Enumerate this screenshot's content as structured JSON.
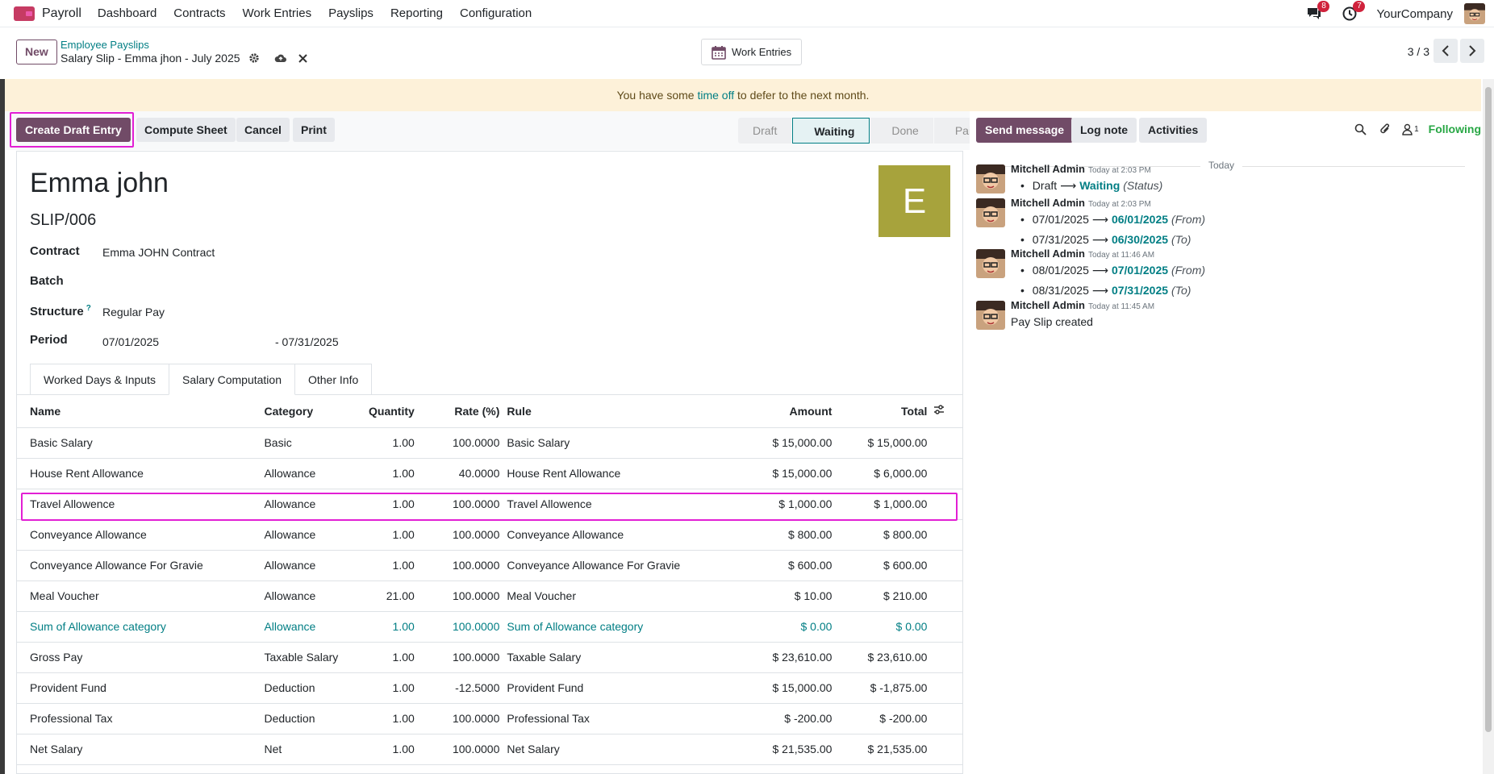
{
  "topbar": {
    "app_name": "Payroll",
    "menu": [
      "Dashboard",
      "Contracts",
      "Work Entries",
      "Payslips",
      "Reporting",
      "Configuration"
    ],
    "messages_badge": "8",
    "activities_badge": "7",
    "company": "YourCompany"
  },
  "control_panel": {
    "new_label": "New",
    "breadcrumb_parent": "Employee Payslips",
    "breadcrumb_current": "Salary Slip - Emma jhon - July 2025",
    "work_entries_label": "Work Entries",
    "pager": "3 / 3"
  },
  "banner": {
    "prefix": "You have some ",
    "link": "time off",
    "suffix": " to defer to the next month."
  },
  "actions": {
    "create_draft": "Create Draft Entry",
    "compute": "Compute Sheet",
    "cancel": "Cancel",
    "print": "Print"
  },
  "statusbar": [
    "Draft",
    "Waiting",
    "Done",
    "Paid"
  ],
  "form": {
    "employee": "Emma john",
    "slip_number": "SLIP/006",
    "avatar_letter": "E",
    "contract_label": "Contract",
    "contract_value": "Emma JOHN Contract",
    "batch_label": "Batch",
    "structure_label": "Structure",
    "structure_help": "?",
    "structure_value": "Regular Pay",
    "period_label": "Period",
    "period_from": "07/01/2025",
    "period_to": "- 07/31/2025"
  },
  "tabs": [
    "Worked Days & Inputs",
    "Salary Computation",
    "Other Info"
  ],
  "table": {
    "headers": [
      "Name",
      "Category",
      "Quantity",
      "Rate (%)",
      "Rule",
      "Amount",
      "Total"
    ],
    "rows": [
      [
        "Basic Salary",
        "Basic",
        "1.00",
        "100.0000",
        "Basic Salary",
        "$ 15,000.00",
        "$ 15,000.00"
      ],
      [
        "House Rent Allowance",
        "Allowance",
        "1.00",
        "40.0000",
        "House Rent Allowance",
        "$ 15,000.00",
        "$ 6,000.00"
      ],
      [
        "Travel Allowence",
        "Allowance",
        "1.00",
        "100.0000",
        "Travel Allowence",
        "$ 1,000.00",
        "$ 1,000.00"
      ],
      [
        "Conveyance Allowance",
        "Allowance",
        "1.00",
        "100.0000",
        "Conveyance Allowance",
        "$ 800.00",
        "$ 800.00"
      ],
      [
        "Conveyance Allowance For Gravie",
        "Allowance",
        "1.00",
        "100.0000",
        "Conveyance Allowance For Gravie",
        "$ 600.00",
        "$ 600.00"
      ],
      [
        "Meal Voucher",
        "Allowance",
        "21.00",
        "100.0000",
        "Meal Voucher",
        "$ 10.00",
        "$ 210.00"
      ],
      [
        "Sum of Allowance category",
        "Allowance",
        "1.00",
        "100.0000",
        "Sum of Allowance category",
        "$ 0.00",
        "$ 0.00"
      ],
      [
        "Gross Pay",
        "Taxable Salary",
        "1.00",
        "100.0000",
        "Taxable Salary",
        "$ 23,610.00",
        "$ 23,610.00"
      ],
      [
        "Provident Fund",
        "Deduction",
        "1.00",
        "-12.5000",
        "Provident Fund",
        "$ 15,000.00",
        "$ -1,875.00"
      ],
      [
        "Professional Tax",
        "Deduction",
        "1.00",
        "100.0000",
        "Professional Tax",
        "$ -200.00",
        "$ -200.00"
      ],
      [
        "Net Salary",
        "Net",
        "1.00",
        "100.0000",
        "Net Salary",
        "$ 21,535.00",
        "$ 21,535.00"
      ]
    ]
  },
  "chatter": {
    "send_message": "Send message",
    "log_note": "Log note",
    "activities": "Activities",
    "followers_count": "1",
    "following": "Following",
    "today": "Today",
    "messages": [
      {
        "author": "Mitchell Admin",
        "time": "Today at 2:03 PM",
        "lines": [
          {
            "old": "Draft",
            "new": "Waiting",
            "field": "(Status)"
          }
        ]
      },
      {
        "author": "Mitchell Admin",
        "time": "Today at 2:03 PM",
        "lines": [
          {
            "old": "07/01/2025",
            "new": "06/01/2025",
            "field": "(From)"
          },
          {
            "old": "07/31/2025",
            "new": "06/30/2025",
            "field": "(To)"
          }
        ]
      },
      {
        "author": "Mitchell Admin",
        "time": "Today at 11:46 AM",
        "lines": [
          {
            "old": "08/01/2025",
            "new": "07/01/2025",
            "field": "(From)"
          },
          {
            "old": "08/31/2025",
            "new": "07/31/2025",
            "field": "(To)"
          }
        ]
      },
      {
        "author": "Mitchell Admin",
        "time": "Today at 11:45 AM",
        "body": "Pay Slip created"
      }
    ]
  },
  "colors": {
    "primary": "#714b67",
    "link": "#017e84",
    "highlight": "#e21fd4",
    "avatar": "#a7a33c",
    "banner": "#fdf1d9"
  }
}
